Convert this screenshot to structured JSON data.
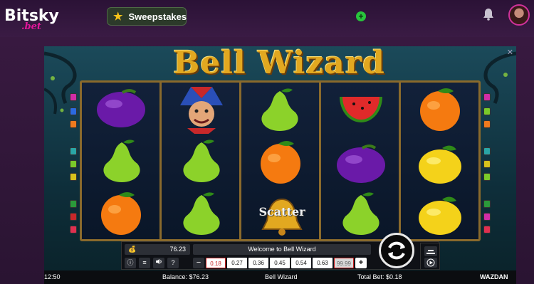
{
  "site": {
    "logo_main": "Bitsky",
    "logo_sub": ".bet",
    "sweepstakes_label": "Sweepstakes"
  },
  "game": {
    "title": "Bell Wizard",
    "close_glyph": "✕",
    "scatter_label": "Scatter",
    "balance_display": "76.23",
    "welcome_message": "Welcome to Bell Wizard",
    "bet_options": [
      "0.18",
      "0.27",
      "0.36",
      "0.45",
      "0.54",
      "0.63",
      "99.99"
    ],
    "selected_bet": "0.18",
    "minus_label": "−",
    "plus_label": "+",
    "info_label": "ⓘ",
    "menu_label": "≡",
    "sound_label": "🔊",
    "help_label": "?"
  },
  "status": {
    "time": "12:50",
    "balance_text": "Balance: $76.23",
    "game_name": "Bell Wizard",
    "total_bet_text": "Total Bet: $0.18",
    "provider": "WAZDAN"
  },
  "reels": [
    [
      "plum",
      "pear",
      "orange"
    ],
    [
      "jester",
      "pear",
      "pear"
    ],
    [
      "pear",
      "orange",
      "scatter-bell"
    ],
    [
      "watermelon",
      "plum",
      "pear"
    ],
    [
      "orange",
      "lemon",
      "lemon"
    ]
  ],
  "colors": {
    "brand_pink": "#e3169b",
    "gold": "#e2a820",
    "reel_border": "#8a6a2c",
    "selected_bet": "#c81e1e"
  }
}
